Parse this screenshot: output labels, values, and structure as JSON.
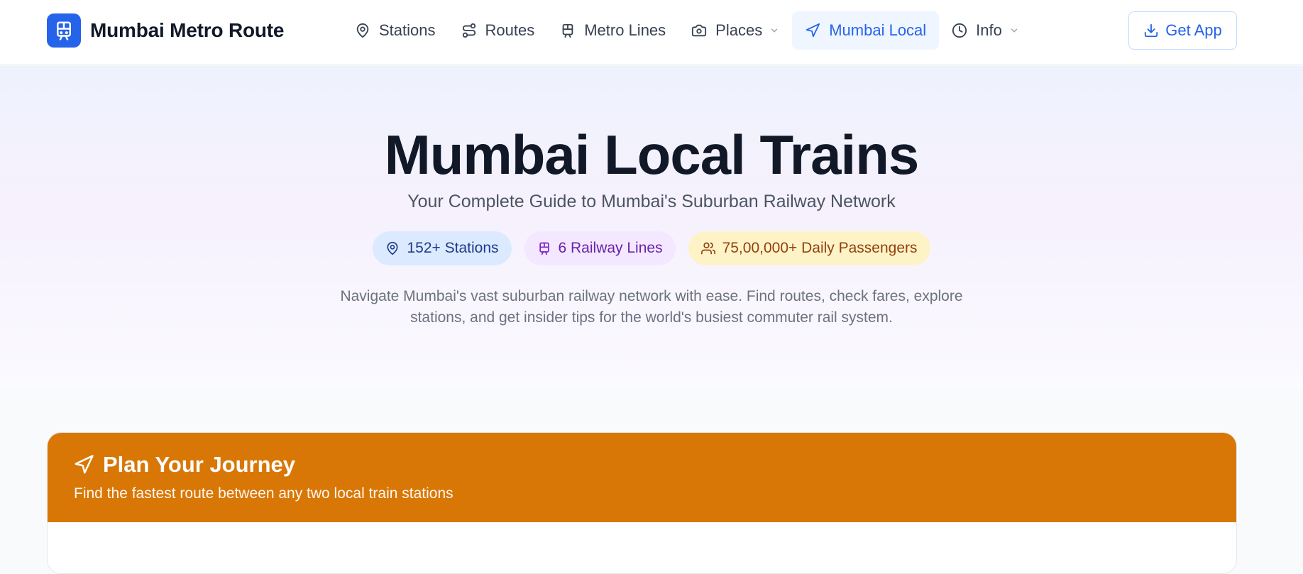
{
  "brand": {
    "name": "Mumbai Metro Route",
    "logo_icon": "train-icon"
  },
  "nav": {
    "items": [
      {
        "label": "Stations",
        "icon": "map-pin-icon"
      },
      {
        "label": "Routes",
        "icon": "route-icon"
      },
      {
        "label": "Metro Lines",
        "icon": "train-icon"
      },
      {
        "label": "Places",
        "icon": "camera-icon",
        "has_dropdown": true
      },
      {
        "label": "Mumbai Local",
        "icon": "navigation-icon",
        "active": true
      },
      {
        "label": "Info",
        "icon": "clock-icon",
        "has_dropdown": true
      }
    ],
    "cta": {
      "label": "Get App",
      "icon": "download-icon"
    }
  },
  "hero": {
    "title": "Mumbai Local Trains",
    "subtitle": "Your Complete Guide to Mumbai's Suburban Railway Network",
    "badges": [
      {
        "label": "152+ Stations",
        "icon": "map-pin-icon",
        "color": "#dbeafe"
      },
      {
        "label": "6 Railway Lines",
        "icon": "train-icon",
        "color": "#f3e8ff"
      },
      {
        "label": "75,00,000+ Daily Passengers",
        "icon": "users-icon",
        "color": "#fef3c7"
      }
    ],
    "description_line1": "Navigate Mumbai's vast suburban railway network with ease. Find routes, check fares, explore",
    "description_line2": "stations, and get insider tips for the world's busiest commuter rail system."
  },
  "journey": {
    "title": "Plan Your Journey",
    "subtitle": "Find the fastest route between any two local train stations",
    "icon": "navigation-icon"
  },
  "colors": {
    "brand_blue": "#2563eb",
    "journey_orange": "#d97706",
    "text_dark": "#111827"
  }
}
